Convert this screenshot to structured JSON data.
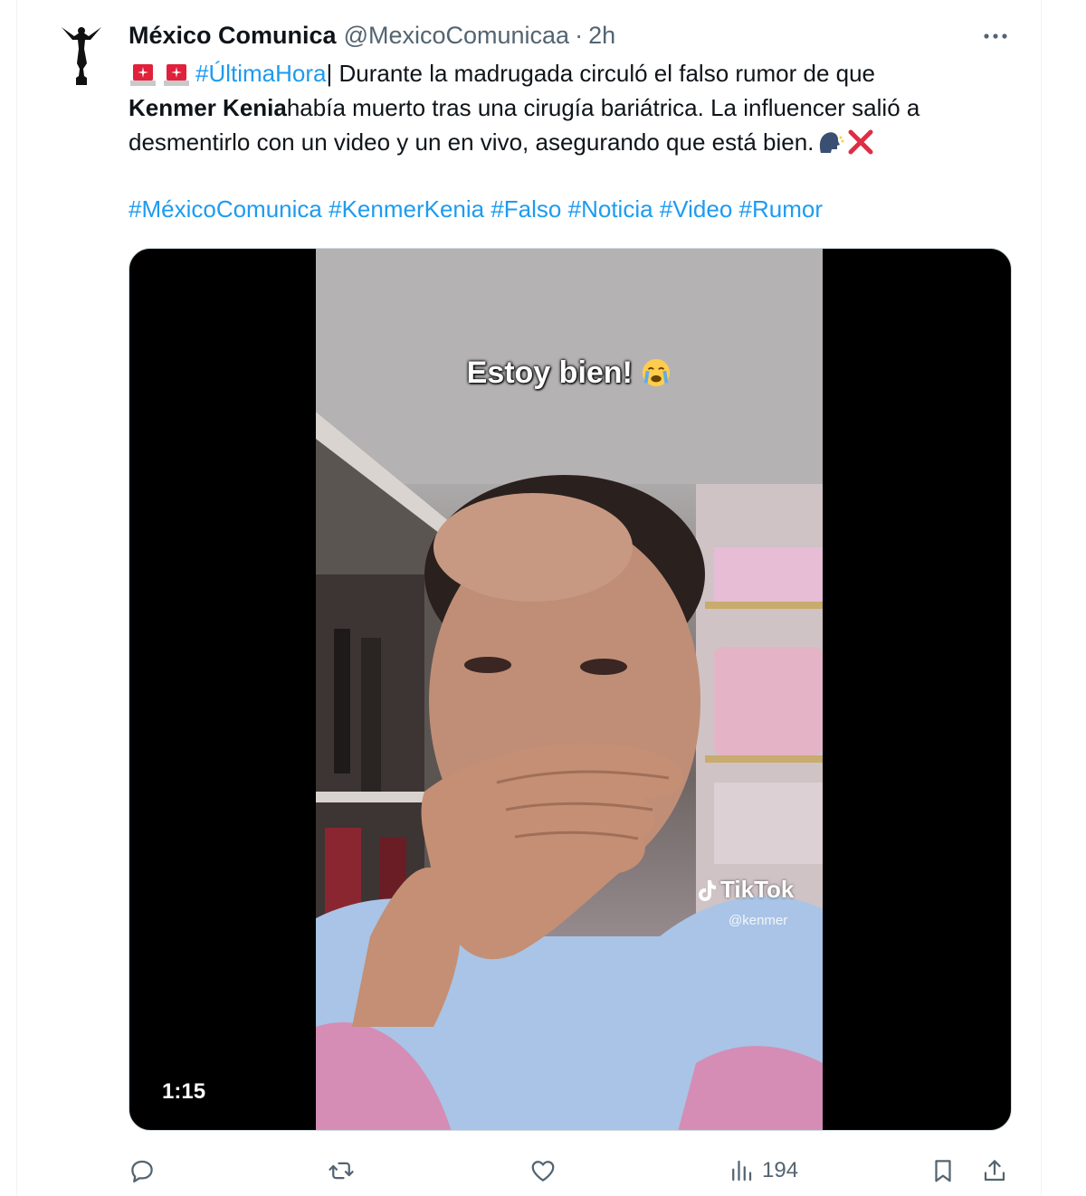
{
  "tweet": {
    "author_name": "México Comunica",
    "author_handle": "@MexicoComunicaa",
    "separator": "·",
    "time": "2h",
    "text_line1_tag": "#ÚltimaHora",
    "text_line1_rest": " | Durante la madrugada circuló el falso rumor de que",
    "text_line2_bold": "Kenmer Kenia",
    "text_line2_rest": " había muerto tras una cirugía bariátrica. La influencer salió a",
    "text_line3": "desmentirlo con un video y un en vivo, asegurando que está bien.",
    "hashtags": [
      "#MéxicoComunica",
      "#KenmerKenia",
      "#Falso",
      "#Noticia",
      "#Video",
      "#Rumor"
    ]
  },
  "media": {
    "caption": "Estoy bien!",
    "duration": "1:15",
    "watermark": "TikTok",
    "watermark_user": "@kenmer"
  },
  "actions": {
    "views": "194"
  },
  "icons": {
    "more": "more-horizontal-icon",
    "reply": "reply-icon",
    "retweet": "retweet-icon",
    "like": "like-icon",
    "views": "views-icon",
    "bookmark": "bookmark-icon",
    "share": "share-icon"
  },
  "colors": {
    "link": "#1d9bf0",
    "secondary": "#536471",
    "text": "#0f1419"
  }
}
